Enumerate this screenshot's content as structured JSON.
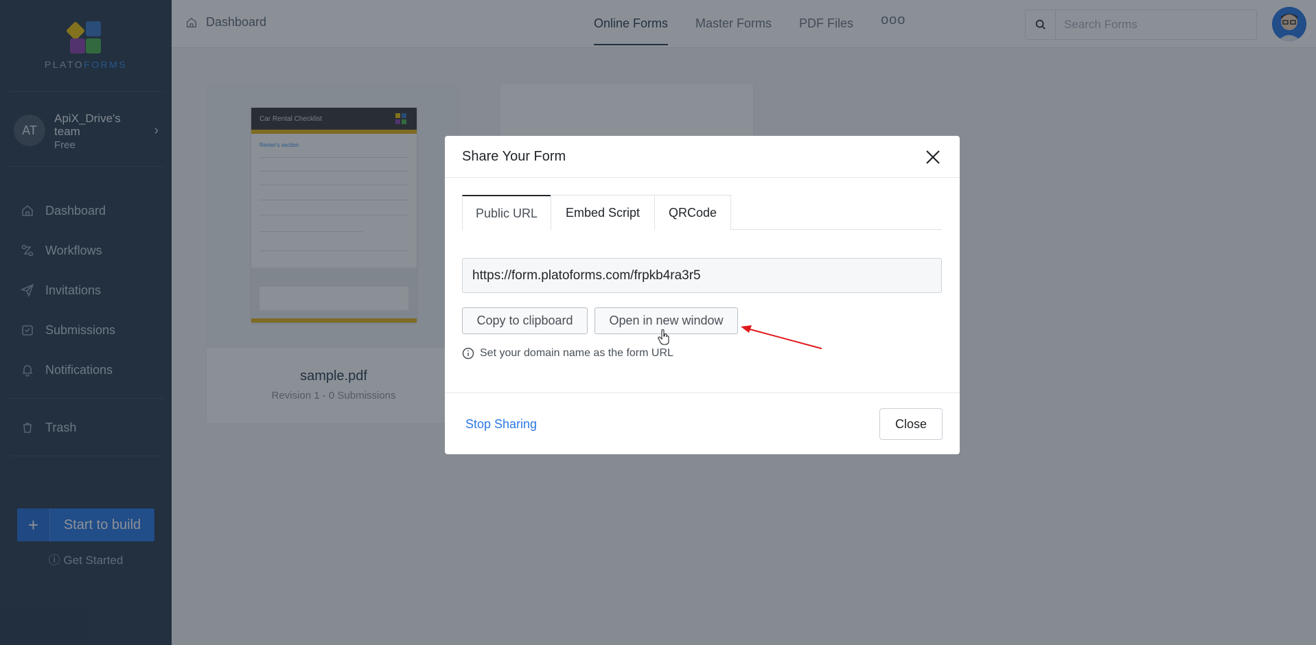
{
  "brand": {
    "logo_primary": "PLATO",
    "logo_secondary": "FORMS"
  },
  "team": {
    "initials": "AT",
    "name": "ApiX_Drive's team",
    "plan": "Free"
  },
  "sidebar": {
    "items": [
      {
        "label": "Dashboard",
        "icon": "home-icon"
      },
      {
        "label": "Workflows",
        "icon": "workflow-icon"
      },
      {
        "label": "Invitations",
        "icon": "send-icon"
      },
      {
        "label": "Submissions",
        "icon": "inbox-icon"
      },
      {
        "label": "Notifications",
        "icon": "bell-icon"
      },
      {
        "label": "Trash",
        "icon": "trash-icon"
      }
    ],
    "build_button": "Start to build",
    "get_started": "Get Started"
  },
  "header": {
    "breadcrumb": "Dashboard",
    "tabs": [
      "Online Forms",
      "Master Forms",
      "PDF Files"
    ],
    "more": "ooo",
    "search_placeholder": "Search Forms"
  },
  "cards": [
    {
      "title": "sample.pdf",
      "meta": "Revision 1 - 0 Submissions",
      "doc_title": "Car Rental Checklist",
      "doc_section": "Renter's section"
    }
  ],
  "modal": {
    "title": "Share Your Form",
    "tabs": [
      "Public URL",
      "Embed Script",
      "QRCode"
    ],
    "url": "https://form.platoforms.com/frpkb4ra3r5",
    "copy_button": "Copy to clipboard",
    "open_button": "Open in new window",
    "hint": "Set your domain name as the form URL",
    "stop_sharing": "Stop Sharing",
    "close_button": "Close"
  },
  "colors": {
    "sidebar_bg": "#2c3e50",
    "accent": "#2b78e4",
    "annotation_arrow": "#e0181b"
  }
}
